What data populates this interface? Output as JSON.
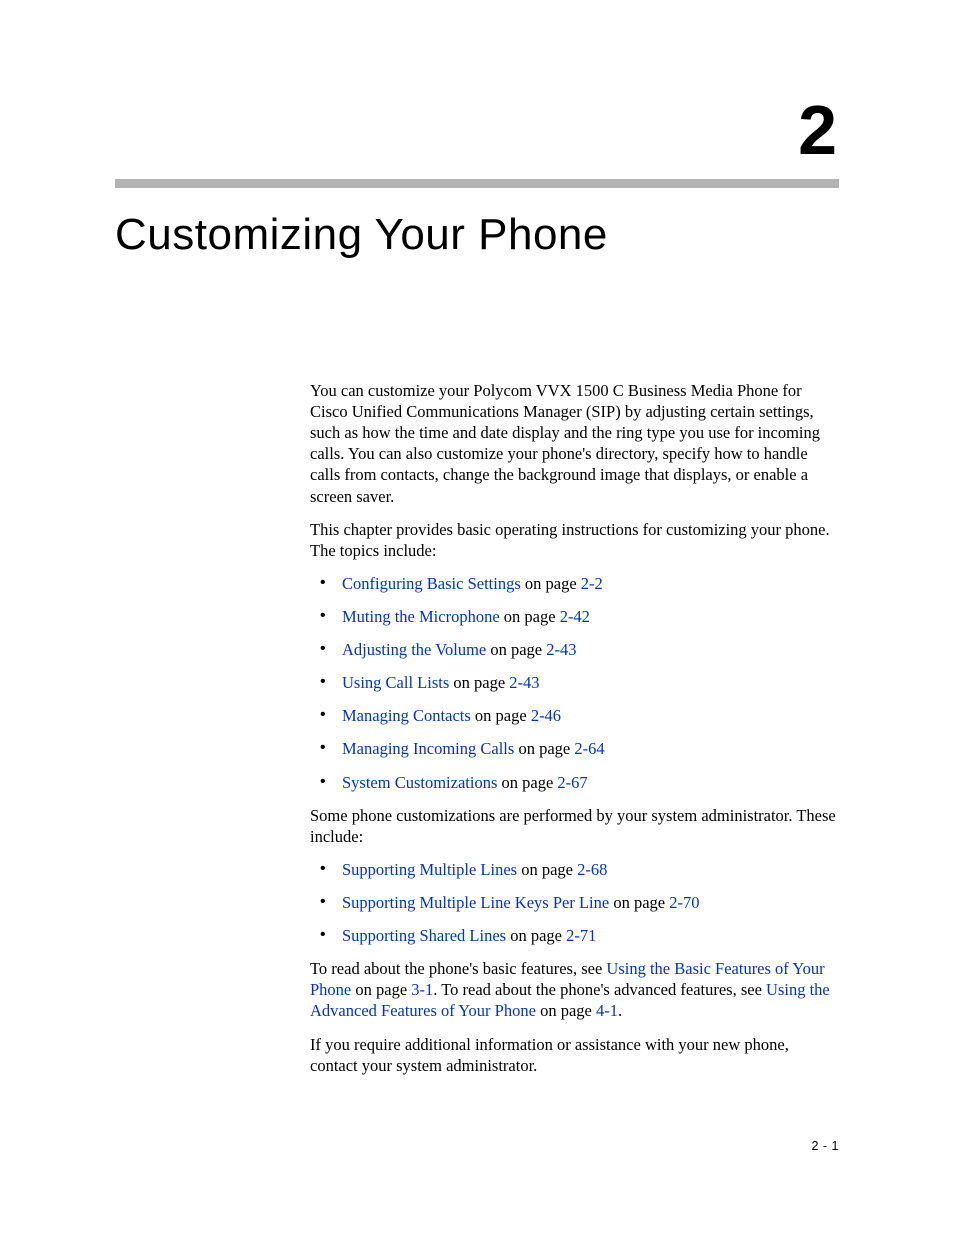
{
  "chapter_number": "2",
  "chapter_title": "Customizing Your Phone",
  "intro_para": "You can customize your Polycom VVX 1500 C Business Media Phone for Cisco Unified Communications Manager (SIP) by adjusting certain settings, such as how the time and date display and the ring type you use for incoming calls. You can also customize your phone's directory, specify how to handle calls from contacts, change the background image that displays, or enable a screen saver.",
  "lead_para": "This chapter provides basic operating instructions for customizing your phone. The topics include:",
  "topics_group_1": [
    {
      "link_text": "Configuring Basic Settings",
      "mid": " on page ",
      "page_ref": "2-2"
    },
    {
      "link_text": "Muting the Microphone",
      "mid": " on page ",
      "page_ref": "2-42"
    },
    {
      "link_text": "Adjusting the Volume",
      "mid": " on page ",
      "page_ref": "2-43"
    },
    {
      "link_text": "Using Call Lists",
      "mid": " on page ",
      "page_ref": "2-43"
    },
    {
      "link_text": "Managing Contacts",
      "mid": " on page ",
      "page_ref": "2-46"
    },
    {
      "link_text": "Managing Incoming Calls",
      "mid": " on page ",
      "page_ref": "2-64"
    },
    {
      "link_text": "System Customizations",
      "mid": " on page ",
      "page_ref": "2-67"
    }
  ],
  "mid_para": "Some phone customizations are performed by your system administrator. These include:",
  "topics_group_2": [
    {
      "link_text": "Supporting Multiple Lines",
      "mid": " on page ",
      "page_ref": "2-68"
    },
    {
      "link_text": "Supporting Multiple Line Keys Per Line",
      "mid": " on page ",
      "page_ref": "2-70"
    },
    {
      "link_text": "Supporting Shared Lines",
      "mid": " on page ",
      "page_ref": "2-71"
    }
  ],
  "closing_para_parts": {
    "t1": "To read about the phone's basic features, see ",
    "l1": "Using the Basic Features of Your Phone",
    "t2": " on page ",
    "p1": "3-1",
    "t3": ". To read about the phone's advanced features, see ",
    "l2": "Using the Advanced Features of Your Phone",
    "t4": " on page ",
    "p2": "4-1",
    "t5": "."
  },
  "final_para": "If you require additional information or assistance with your new phone, contact your system administrator.",
  "page_number": "2 - 1"
}
